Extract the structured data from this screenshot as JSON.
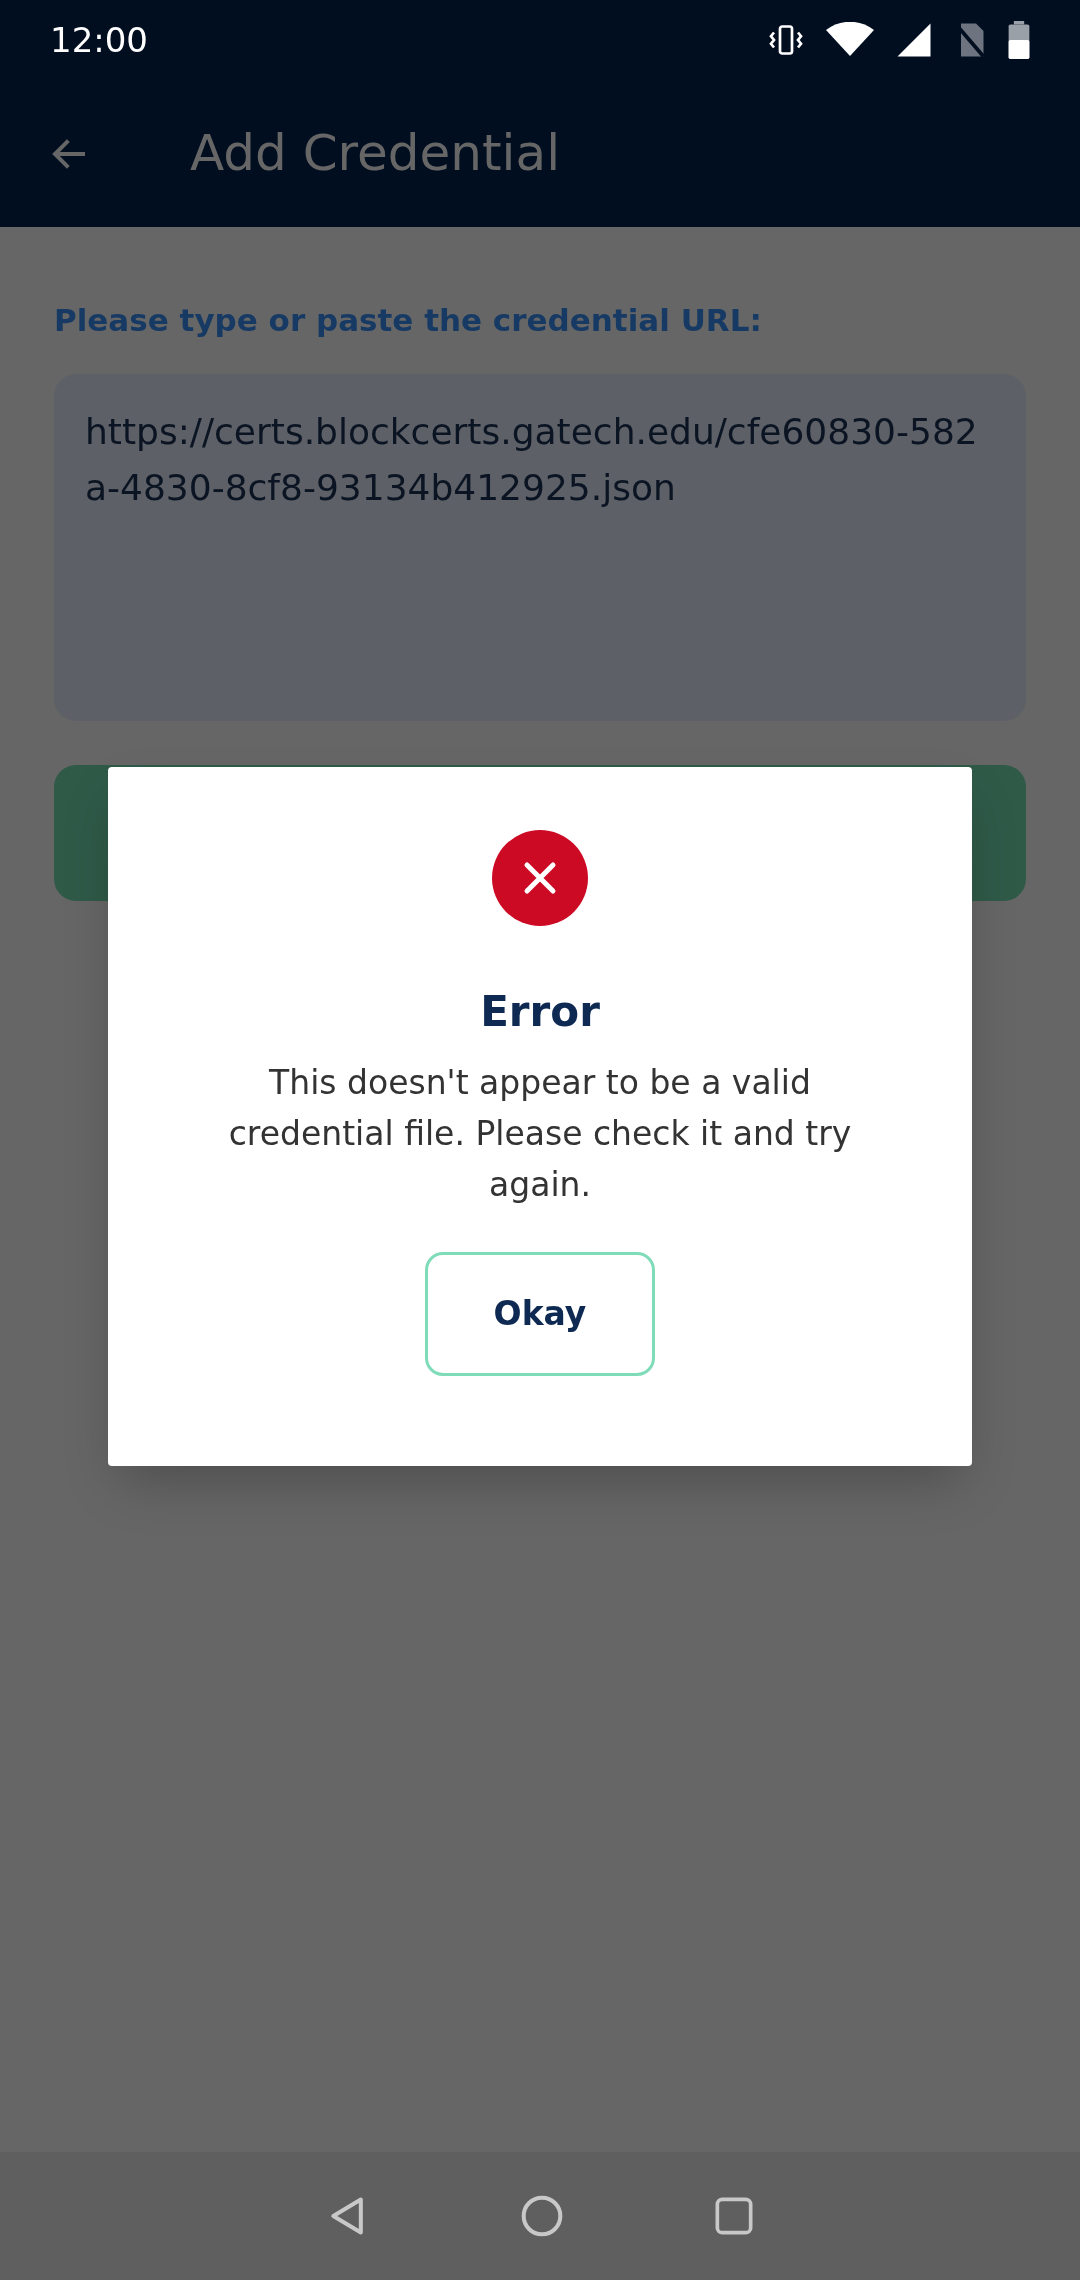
{
  "status_bar": {
    "time": "12:00"
  },
  "app_bar": {
    "title": "Add Credential"
  },
  "form": {
    "label": "Please type or paste the credential URL:",
    "url_field": {
      "value": "https://certs.blockcerts.gatech.edu/cfe60830-582a-4830-8cf8-93134b412925.json"
    }
  },
  "dialog": {
    "title": "Error",
    "message": "This doesn't appear to be a valid credential file. Please check it and try again.",
    "button": "Okay"
  }
}
